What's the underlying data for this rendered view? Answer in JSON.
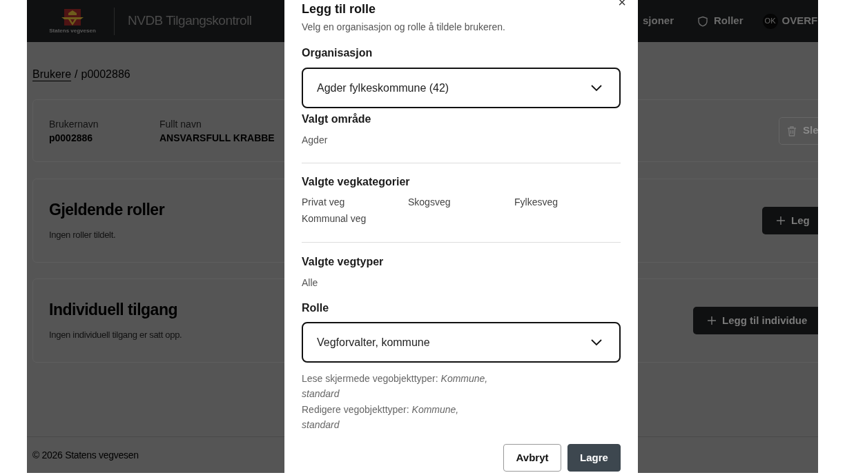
{
  "header": {
    "logo_text": "Statens vegvesen",
    "app_title": "NVDB Tilgangskontroll",
    "nav": [
      {
        "label": "sjoner"
      },
      {
        "label": "Roller"
      }
    ],
    "user": {
      "initials": "OK",
      "name": "OVERF"
    }
  },
  "breadcrumb": {
    "separator": "/",
    "items": [
      {
        "label": "Brukere",
        "link": true
      },
      {
        "label": "p0002886",
        "link": false
      }
    ]
  },
  "user_card": {
    "fields": [
      {
        "label": "Brukernavn",
        "value": "p0002886"
      },
      {
        "label": "Fullt navn",
        "value": "ANSVARSFULL KRABBE"
      }
    ],
    "button": {
      "label": "Sle"
    }
  },
  "sections": [
    {
      "title": "Gjeldende roller",
      "empty_text": "Ingen roller tildelt.",
      "button": {
        "label": "Leg"
      }
    },
    {
      "title": "Individuell tilgang",
      "empty_text": "Ingen individuell tilgang er satt opp.",
      "button": {
        "label": "Legg til individue"
      }
    }
  ],
  "footer": "© 2026 Statens vegvesen",
  "dialog": {
    "title": "Legg til rolle",
    "subtitle": "Velg en organisasjon og rolle å tildele brukeren.",
    "close": "×",
    "organisation": {
      "label": "Organisasjon",
      "value": "Agder fylkeskommune (42)"
    },
    "selected_area": {
      "label": "Valgt område",
      "value": "Agder"
    },
    "road_categories": {
      "label": "Valgte vegkategorier",
      "items": [
        "Privat veg",
        "Skogsveg",
        "Fylkesveg",
        "Kommunal veg"
      ]
    },
    "road_types": {
      "label": "Valgte vegtyper",
      "value": "Alle"
    },
    "role": {
      "label": "Rolle",
      "value": "Vegforvalter, kommune"
    },
    "permissions": [
      "Lese skjermede vegobjekttyper: *Kommune, standard*",
      "Redigere vegobjekttyper: *Kommune, standard*"
    ],
    "actions": [
      {
        "label": "Avbryt",
        "kind": "secondary"
      },
      {
        "label": "Lagre",
        "kind": "primary"
      }
    ]
  }
}
